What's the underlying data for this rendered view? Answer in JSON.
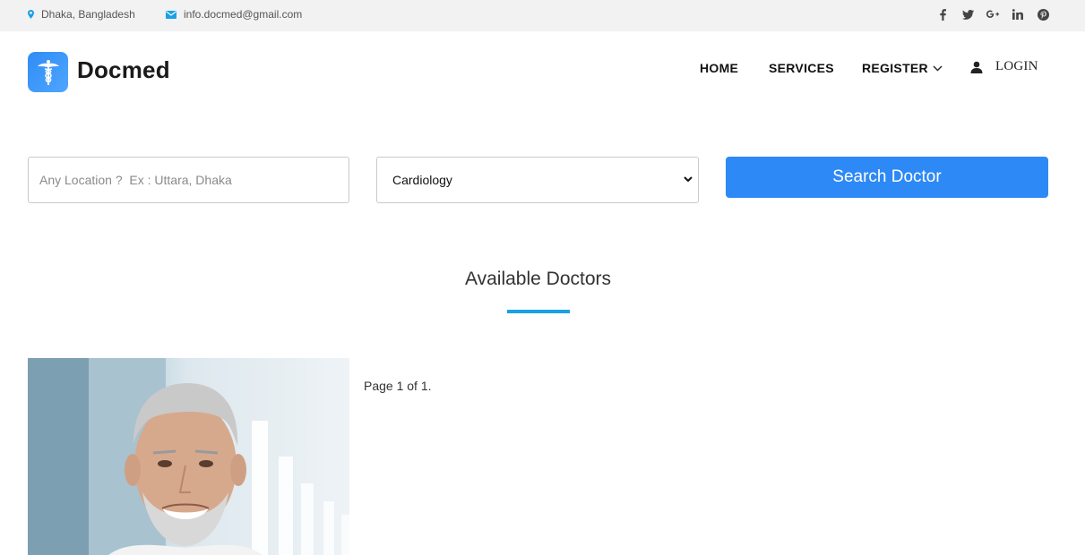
{
  "topbar": {
    "location": "Dhaka, Bangladesh",
    "email": "info.docmed@gmail.com",
    "socials": [
      "facebook-icon",
      "twitter-icon",
      "google-plus-icon",
      "linkedin-icon",
      "pinterest-icon"
    ]
  },
  "brand": {
    "name": "Docmed",
    "accent": "#2f8cf5"
  },
  "nav": {
    "home": "HOME",
    "services": "SERVICES",
    "register": "REGISTER",
    "login": "LOGIN"
  },
  "search": {
    "location_placeholder": "Any Location ?  Ex : Uttara, Dhaka",
    "location_value": "",
    "specialty_selected": "Cardiology",
    "button_label": "Search Doctor",
    "button_color": "#2d89f5"
  },
  "section": {
    "title": "Available Doctors",
    "underline_color": "#1aa0e6"
  },
  "results": {
    "page_info": "Page 1 of 1."
  }
}
